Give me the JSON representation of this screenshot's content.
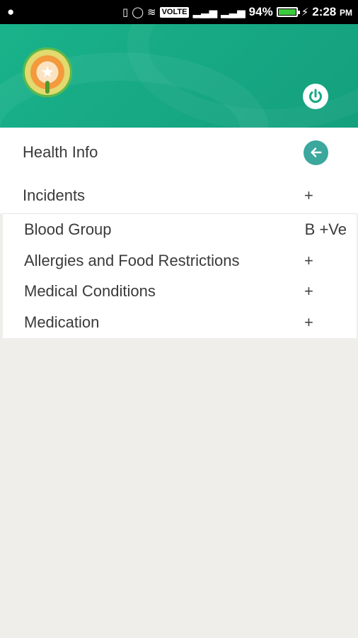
{
  "status_bar": {
    "battery_percent": "94%",
    "volte": "VOLTE",
    "time": "2:28",
    "ampm": "PM"
  },
  "header": {
    "power_icon": "power-icon",
    "logo_icon": "logo-icon"
  },
  "menu": {
    "health_info_label": "Health Info",
    "incidents_label": "Incidents",
    "incidents_action": "+"
  },
  "health": {
    "rows": [
      {
        "label": "Blood Group",
        "value": "B +Ve"
      },
      {
        "label": "Allergies and Food Restrictions",
        "value": "+"
      },
      {
        "label": "Medical Conditions",
        "value": "+"
      },
      {
        "label": "Medication",
        "value": "+"
      }
    ]
  },
  "colors": {
    "header_green": "#17a884",
    "back_button": "#3ba79d",
    "background": "#efeeeb"
  }
}
